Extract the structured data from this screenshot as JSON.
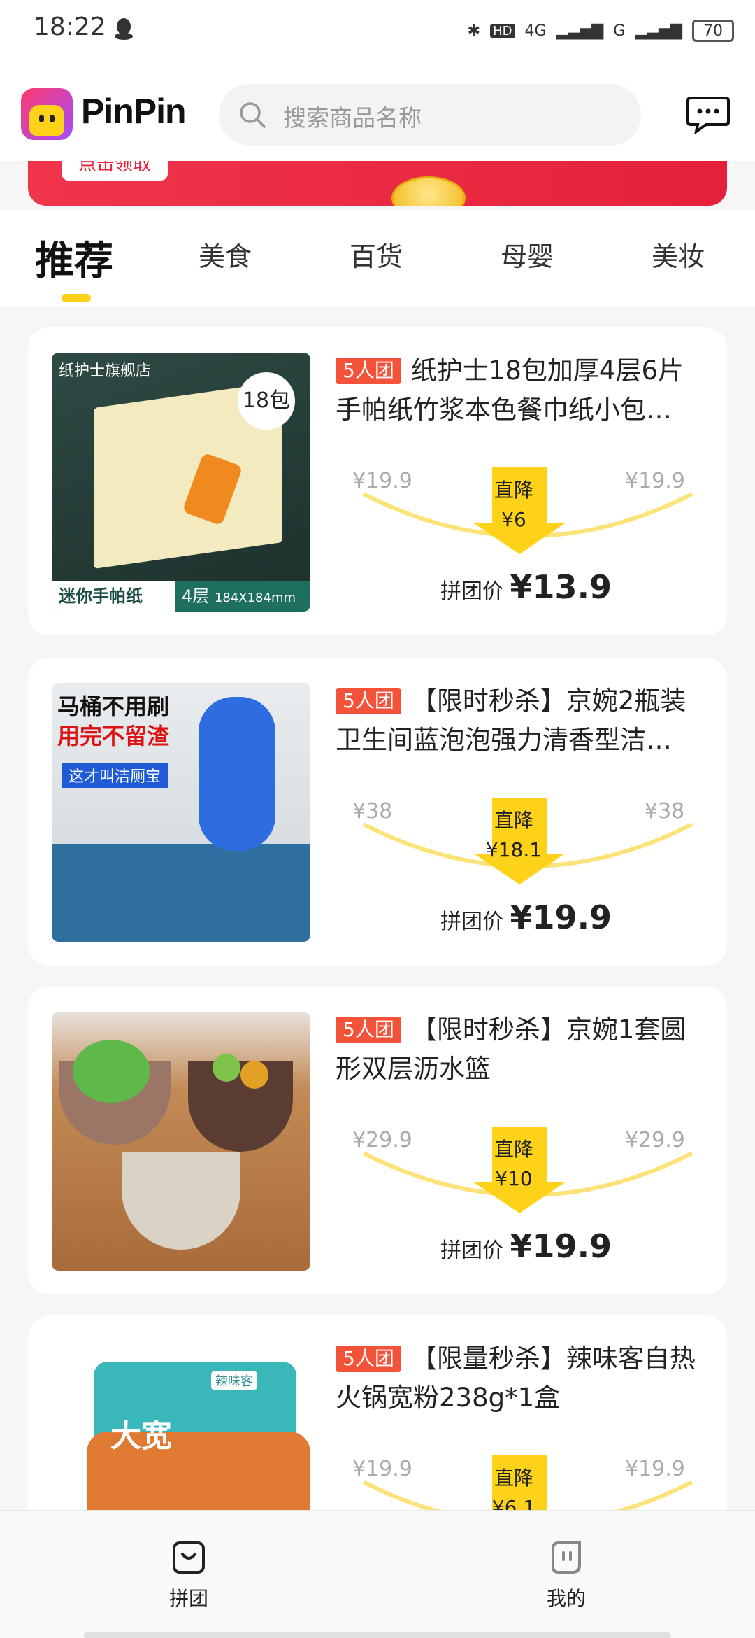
{
  "status_bar": {
    "time": "18:22",
    "battery": "70",
    "net1": "4G",
    "net2": "G"
  },
  "header": {
    "brand": "PinPin",
    "search_placeholder": "搜索商品名称"
  },
  "banner": {
    "button_label": "点击领取"
  },
  "tabs": [
    {
      "label": "推荐",
      "active": true
    },
    {
      "label": "美食"
    },
    {
      "label": "百货"
    },
    {
      "label": "母婴"
    },
    {
      "label": "美妆"
    }
  ],
  "products": [
    {
      "badge": "5人团",
      "title": "纸护士18包加厚4层6片手帕纸竹浆本色餐巾纸小包…",
      "orig_left": "¥19.9",
      "orig_right": "¥19.9",
      "drop_label": "直降",
      "drop_value": "¥6",
      "group_label": "拼团价",
      "group_price": "¥13.9",
      "img_texts": {
        "store": "纸护士旗舰店",
        "count": "18包",
        "tag1": "迷你手帕纸",
        "tag2": "4层",
        "tag3": "184X184mm"
      }
    },
    {
      "badge": "5人团",
      "title": "【限时秒杀】京婉2瓶装卫生间蓝泡泡强力清香型洁…",
      "orig_left": "¥38",
      "orig_right": "¥38",
      "drop_label": "直降",
      "drop_value": "¥18.1",
      "group_label": "拼团价",
      "group_price": "¥19.9",
      "img_texts": {
        "line1": "马桶不用刷",
        "line2": "用完不留渣",
        "line3": "这才叫洁厕宝"
      }
    },
    {
      "badge": "5人团",
      "title": "【限时秒杀】京婉1套圆形双层沥水篮",
      "orig_left": "¥29.9",
      "orig_right": "¥29.9",
      "drop_label": "直降",
      "drop_value": "¥10",
      "group_label": "拼团价",
      "group_price": "¥19.9"
    },
    {
      "badge": "5人团",
      "title": "【限量秒杀】辣味客自热火锅宽粉238g*1盒",
      "orig_left": "¥19.9",
      "orig_right": "¥19.9",
      "drop_label": "直降",
      "drop_value": "¥6.1",
      "img_texts": {
        "brand": "辣味客",
        "big": "大宽"
      }
    }
  ],
  "bottom_nav": [
    {
      "label": "拼团",
      "icon": "bag-icon"
    },
    {
      "label": "我的",
      "icon": "profile-icon"
    }
  ],
  "colors": {
    "accent": "#ffd21a",
    "badge": "#f5523a",
    "banner": "#e5203b"
  }
}
